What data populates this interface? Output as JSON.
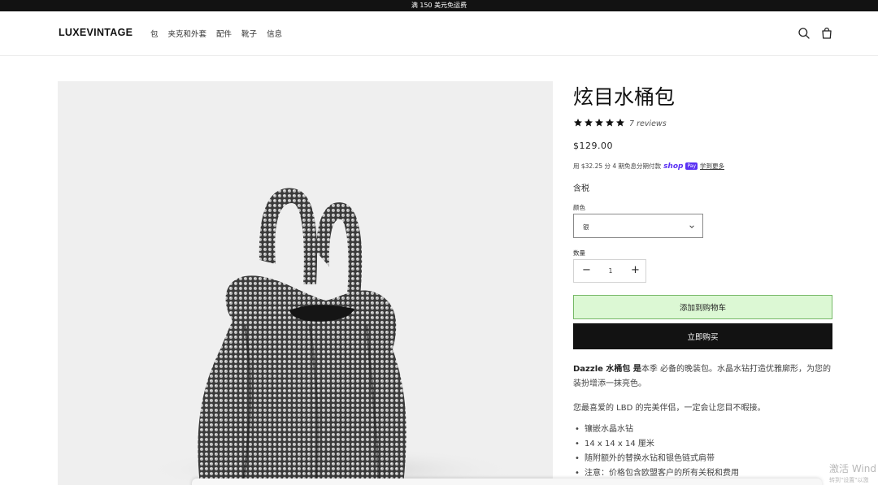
{
  "announcement": "满 150 美元免运费",
  "header": {
    "logo": "LUXEVINTAGE",
    "nav": [
      "包",
      "夹克和外套",
      "配件",
      "靴子",
      "信息"
    ],
    "icons": [
      "search-icon",
      "cart-icon"
    ]
  },
  "product": {
    "title": "炫目水桶包",
    "rating": 5,
    "reviews": "7 reviews",
    "price": "$129.00",
    "installment": {
      "text": "用 $32.25 分 4 期免息分期付款",
      "shop_logo": "shop",
      "pay_badge": "Pay",
      "learn_more": "学到更多"
    },
    "tax": "含税",
    "color_label": "颜色",
    "color_value": "银",
    "quantity_label": "数量",
    "quantity_minus": "−",
    "quantity": "1",
    "quantity_plus": "+",
    "add_to_cart": "添加到购物车",
    "buy_now": "立即购买",
    "description": {
      "p1_bold": "Dazzle 水桶包 是",
      "p1_rest": "本季 必备的晚装包。水晶水钻打造优雅廓形，为您的装扮增添一抹亮色。",
      "p2": "您最喜爱的 LBD 的完美伴侣，一定会让您目不暇接。",
      "bullets": [
        "镶嵌水晶水钻",
        "14 x 14 x 14 厘米",
        "随附额外的替换水钻和银色链式肩带",
        "注意：价格包含欧盟客户的所有关税和费用"
      ]
    }
  },
  "watermark": {
    "line1": "激活 Wind",
    "line2": "转到\"设置\"以激"
  },
  "colors": {
    "topbar": "#121212",
    "add_to_cart_bg": "#dcf8d4",
    "add_to_cart_border": "#76b867",
    "buy_now_bg": "#121212",
    "shop_pay": "#5a31f4",
    "star": "#111111"
  }
}
